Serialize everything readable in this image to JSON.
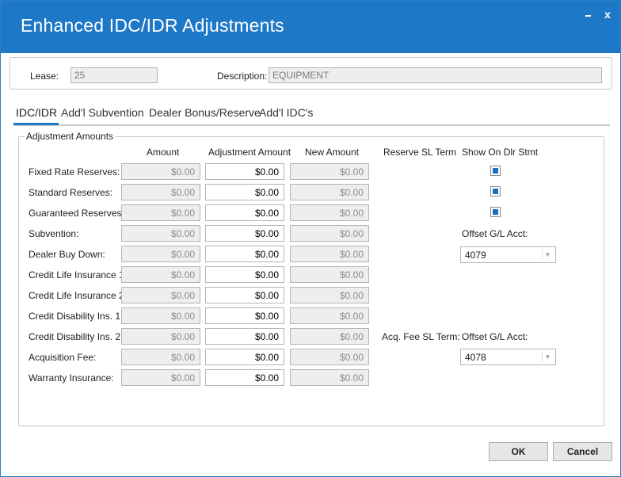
{
  "window": {
    "title": "Enhanced IDC/IDR Adjustments",
    "close_glyph": "x"
  },
  "header": {
    "lease_label": "Lease:",
    "lease_value": "25",
    "description_label": "Description:",
    "description_value": "EQUIPMENT"
  },
  "tabs": [
    {
      "label": "IDC/IDR",
      "active": true
    },
    {
      "label": "Add'l Subvention",
      "active": false
    },
    {
      "label": "Dealer Bonus/Reserve",
      "active": false
    },
    {
      "label": "Add'l IDC's",
      "active": false
    }
  ],
  "group": {
    "title": "Adjustment Amounts",
    "col_amount": "Amount",
    "col_adjustment": "Adjustment Amount",
    "col_new": "New Amount",
    "col_reserve_sl_term": "Reserve SL Term",
    "col_show_on_dlr_stmt": "Show On Dlr Stmt"
  },
  "rows": [
    {
      "label": "Fixed Rate Reserves:",
      "amount": "$0.00",
      "adjustment": "$0.00",
      "new_amount": "$0.00"
    },
    {
      "label": "Standard Reserves:",
      "amount": "$0.00",
      "adjustment": "$0.00",
      "new_amount": "$0.00"
    },
    {
      "label": "Guaranteed Reserves:",
      "amount": "$0.00",
      "adjustment": "$0.00",
      "new_amount": "$0.00"
    },
    {
      "label": "Subvention:",
      "amount": "$0.00",
      "adjustment": "$0.00",
      "new_amount": "$0.00"
    },
    {
      "label": "Dealer Buy Down:",
      "amount": "$0.00",
      "adjustment": "$0.00",
      "new_amount": "$0.00"
    },
    {
      "label": "Credit Life Insurance 1:",
      "amount": "$0.00",
      "adjustment": "$0.00",
      "new_amount": "$0.00"
    },
    {
      "label": "Credit Life Insurance 2:",
      "amount": "$0.00",
      "adjustment": "$0.00",
      "new_amount": "$0.00"
    },
    {
      "label": "Credit Disability Ins. 1:",
      "amount": "$0.00",
      "adjustment": "$0.00",
      "new_amount": "$0.00"
    },
    {
      "label": "Credit Disability Ins. 2:",
      "amount": "$0.00",
      "adjustment": "$0.00",
      "new_amount": "$0.00"
    },
    {
      "label": "Acquisition Fee:",
      "amount": "$0.00",
      "adjustment": "$0.00",
      "new_amount": "$0.00"
    },
    {
      "label": "Warranty Insurance:",
      "amount": "$0.00",
      "adjustment": "$0.00",
      "new_amount": "$0.00"
    }
  ],
  "checkboxes": [
    {
      "row": "Fixed Rate Reserves",
      "checked": true
    },
    {
      "row": "Standard Reserves",
      "checked": true
    },
    {
      "row": "Guaranteed Reserves",
      "checked": true
    }
  ],
  "offset_subvention": {
    "label": "Offset G/L Acct:",
    "value": "4079"
  },
  "acq_fee": {
    "sl_term_label": "Acq. Fee SL Term:",
    "offset_label": "Offset G/L Acct:",
    "value": "4078"
  },
  "buttons": {
    "ok": "OK",
    "cancel": "Cancel"
  },
  "colors": {
    "title_bar": "#1e78c8",
    "checkbox_fill": "#1e6fc0"
  }
}
